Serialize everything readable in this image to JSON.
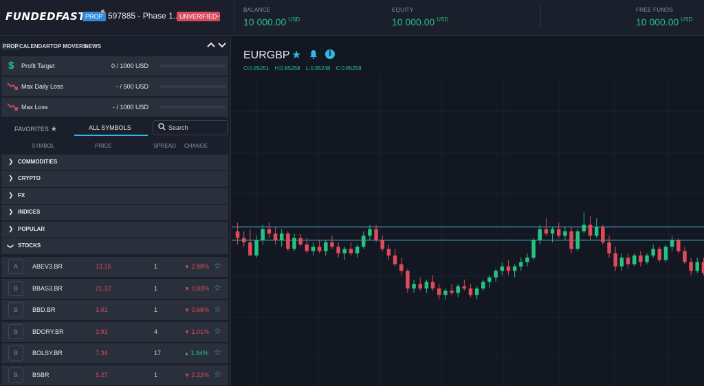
{
  "header": {
    "logo": "FUNDEDFAST",
    "prop_badge": "PROP",
    "account": "597885 - Phase 1...",
    "status_badge": "UNVERIFIED",
    "metrics": [
      {
        "label": "BALANCE",
        "value": "10 000.00",
        "currency": "USD"
      },
      {
        "label": "EQUITY",
        "value": "10 000.00",
        "currency": "USD"
      },
      {
        "label": "FREE FUNDS",
        "value": "10 000.00",
        "currency": "USD"
      }
    ]
  },
  "sidebar": {
    "tabs": [
      "PROP",
      "CALENDAR",
      "TOP MOVERS",
      "NEWS"
    ],
    "rules": [
      {
        "label": "Profit Target",
        "value": "0 / 1000 USD",
        "icon": "dollar-icon",
        "progress": 0
      },
      {
        "label": "Max Daily Loss",
        "value": "- / 500 USD",
        "icon": "trend-down-icon",
        "progress": 0
      },
      {
        "label": "Max Loss",
        "value": "- / 1000 USD",
        "icon": "trend-down-icon",
        "progress": 0
      }
    ],
    "symbol_tabs": {
      "favorites": "FAVORITES",
      "all": "ALL SYMBOLS"
    },
    "search": {
      "placeholder": "Search"
    },
    "columns": [
      "SYMBOL",
      "PRICE",
      "SPREAD",
      "CHANGE"
    ],
    "categories": [
      "COMMODITIES",
      "CRYPTO",
      "FX",
      "INDICES",
      "POPULAR",
      "STOCKS"
    ],
    "stocks": [
      {
        "logo": "A",
        "symbol": "ABEV3.BR",
        "price": "13.15",
        "spread": "1",
        "change": "2.88%",
        "direction": "down"
      },
      {
        "logo": "B",
        "symbol": "BBAS3.BR",
        "price": "21.32",
        "spread": "1",
        "change": "0.83%",
        "direction": "down"
      },
      {
        "logo": "B",
        "symbol": "BBD.BR",
        "price": "3.01",
        "spread": "1",
        "change": "0.66%",
        "direction": "down"
      },
      {
        "logo": "B",
        "symbol": "BDORY.BR",
        "price": "3.91",
        "spread": "4",
        "change": "1.01%",
        "direction": "down"
      },
      {
        "logo": "B",
        "symbol": "BOLSY.BR",
        "price": "7.34",
        "spread": "17",
        "change": "1.94%",
        "direction": "up"
      },
      {
        "logo": "B",
        "symbol": "BSBR",
        "price": "5.27",
        "spread": "1",
        "change": "2.22%",
        "direction": "down"
      }
    ]
  },
  "chart": {
    "symbol": "EURGBP",
    "ohlc": {
      "open": "O:0.85251",
      "high": "H:0.85258",
      "low": "L:0.85248",
      "close": "C:0.85258"
    }
  },
  "colors": {
    "up": "#26c281",
    "down": "#e04b5a",
    "accent": "#2db8e8",
    "panel": "#2a2f3c",
    "background": "#131722"
  },
  "chart_data": {
    "type": "candlestick",
    "series": [
      {
        "values": [
          [
            0.85256,
            0.8526,
            0.8525,
            0.85253
          ],
          [
            0.85253,
            0.85256,
            0.85249,
            0.85251
          ],
          [
            0.85251,
            0.85257,
            0.85246,
            0.85245
          ],
          [
            0.85245,
            0.85254,
            0.85244,
            0.85252
          ],
          [
            0.85252,
            0.85259,
            0.8525,
            0.85257
          ],
          [
            0.85257,
            0.8526,
            0.85253,
            0.85255
          ],
          [
            0.85255,
            0.85258,
            0.8525,
            0.85252
          ],
          [
            0.85252,
            0.85257,
            0.85249,
            0.85255
          ],
          [
            0.85255,
            0.85256,
            0.85247,
            0.85248
          ],
          [
            0.85248,
            0.85255,
            0.85247,
            0.85253
          ],
          [
            0.85253,
            0.85255,
            0.85249,
            0.8525
          ],
          [
            0.8525,
            0.85253,
            0.85246,
            0.85247
          ],
          [
            0.85247,
            0.85251,
            0.85245,
            0.85249
          ],
          [
            0.85249,
            0.85252,
            0.85246,
            0.85247
          ],
          [
            0.85247,
            0.85252,
            0.85245,
            0.85251
          ],
          [
            0.85251,
            0.85254,
            0.85248,
            0.85249
          ],
          [
            0.85249,
            0.85251,
            0.85244,
            0.85246
          ],
          [
            0.85246,
            0.85249,
            0.85243,
            0.85248
          ],
          [
            0.85248,
            0.85251,
            0.85245,
            0.85246
          ],
          [
            0.85246,
            0.8525,
            0.85244,
            0.85249
          ],
          [
            0.85249,
            0.85256,
            0.85248,
            0.85254
          ],
          [
            0.85254,
            0.85259,
            0.85252,
            0.85257
          ],
          [
            0.85257,
            0.85259,
            0.85251,
            0.85252
          ],
          [
            0.85252,
            0.85254,
            0.85247,
            0.85248
          ],
          [
            0.85248,
            0.8525,
            0.85243,
            0.85245
          ],
          [
            0.85245,
            0.85248,
            0.8524,
            0.85241
          ],
          [
            0.85241,
            0.85244,
            0.85236,
            0.85238
          ],
          [
            0.85238,
            0.85239,
            0.85228,
            0.8523
          ],
          [
            0.8523,
            0.85234,
            0.85228,
            0.85232
          ],
          [
            0.85232,
            0.85235,
            0.85229,
            0.8523
          ],
          [
            0.8523,
            0.85234,
            0.85228,
            0.85233
          ],
          [
            0.85233,
            0.85236,
            0.85229,
            0.8523
          ],
          [
            0.8523,
            0.85232,
            0.85225,
            0.85227
          ],
          [
            0.85227,
            0.8523,
            0.85225,
            0.85229
          ],
          [
            0.85229,
            0.85232,
            0.85227,
            0.85228
          ],
          [
            0.85228,
            0.85232,
            0.85226,
            0.85231
          ],
          [
            0.85231,
            0.85234,
            0.85229,
            0.8523
          ],
          [
            0.8523,
            0.85232,
            0.85226,
            0.85227
          ],
          [
            0.85227,
            0.85231,
            0.85225,
            0.8523
          ],
          [
            0.8523,
            0.85234,
            0.85229,
            0.85233
          ],
          [
            0.85233,
            0.85236,
            0.8523,
            0.85235
          ],
          [
            0.85235,
            0.85239,
            0.85233,
            0.85238
          ],
          [
            0.85238,
            0.85242,
            0.85236,
            0.8524
          ],
          [
            0.8524,
            0.85243,
            0.85236,
            0.85238
          ],
          [
            0.85238,
            0.85241,
            0.85235,
            0.8524
          ],
          [
            0.8524,
            0.85244,
            0.85238,
            0.85242
          ],
          [
            0.85242,
            0.85246,
            0.8524,
            0.85244
          ],
          [
            0.85244,
            0.85253,
            0.85243,
            0.85252
          ],
          [
            0.85252,
            0.85259,
            0.8525,
            0.85257
          ],
          [
            0.85257,
            0.85262,
            0.85254,
            0.85255
          ],
          [
            0.85255,
            0.85258,
            0.85251,
            0.85257
          ],
          [
            0.85257,
            0.8526,
            0.85253,
            0.85254
          ],
          [
            0.85254,
            0.85258,
            0.85252,
            0.85256
          ],
          [
            0.85256,
            0.85258,
            0.85246,
            0.85248
          ],
          [
            0.85248,
            0.85257,
            0.85247,
            0.85256
          ],
          [
            0.85256,
            0.85265,
            0.85255,
            0.85259
          ],
          [
            0.85259,
            0.85263,
            0.85252,
            0.85254
          ],
          [
            0.85254,
            0.85262,
            0.85253,
            0.85258
          ],
          [
            0.85258,
            0.85259,
            0.8525,
            0.85251
          ],
          [
            0.85251,
            0.85254,
            0.85244,
            0.85246
          ],
          [
            0.85246,
            0.85249,
            0.85238,
            0.8524
          ],
          [
            0.8524,
            0.85246,
            0.85238,
            0.85244
          ],
          [
            0.85244,
            0.85246,
            0.85239,
            0.85241
          ],
          [
            0.85241,
            0.85246,
            0.8524,
            0.85245
          ],
          [
            0.85245,
            0.85247,
            0.8524,
            0.85242
          ],
          [
            0.85242,
            0.85246,
            0.85241,
            0.85245
          ],
          [
            0.85245,
            0.8525,
            0.85244,
            0.85248
          ],
          [
            0.85248,
            0.85249,
            0.85242,
            0.85243
          ],
          [
            0.85243,
            0.8525,
            0.85242,
            0.85249
          ],
          [
            0.85249,
            0.85254,
            0.85247,
            0.85252
          ],
          [
            0.85252,
            0.85253,
            0.85246,
            0.85247
          ],
          [
            0.85247,
            0.85249,
            0.85241,
            0.85242
          ],
          [
            0.85242,
            0.85244,
            0.85236,
            0.85238
          ],
          [
            0.85238,
            0.85244,
            0.85237,
            0.85242
          ],
          [
            0.85242,
            0.85244,
            0.85236,
            0.85237
          ]
        ]
      }
    ],
    "reference_lines": [
      0.85258,
      0.85252
    ]
  }
}
